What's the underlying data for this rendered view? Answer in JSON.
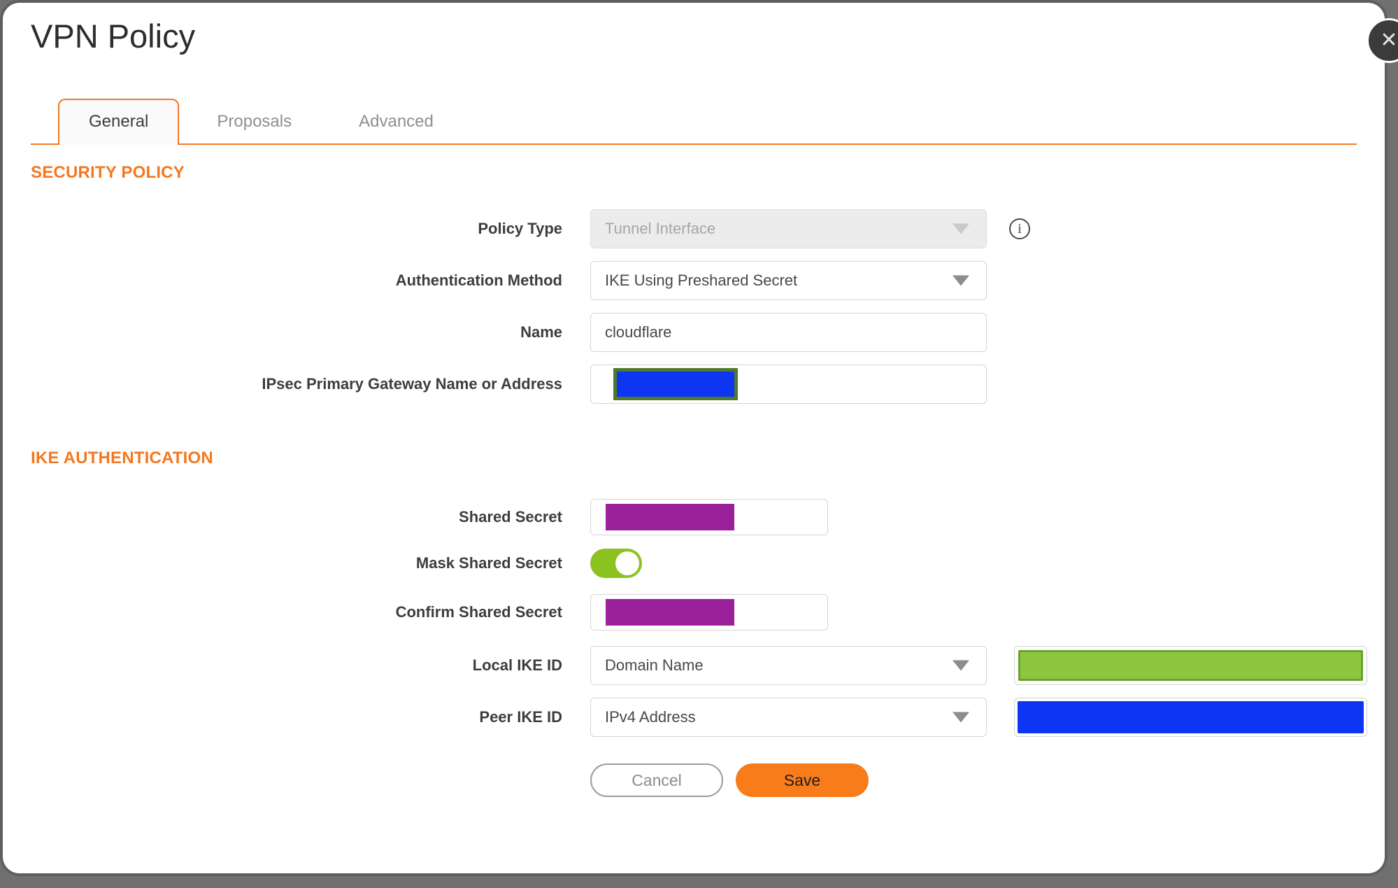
{
  "dialog": {
    "title": "VPN Policy"
  },
  "icons": {
    "close": "✕",
    "info": "i"
  },
  "tabs": [
    {
      "label": "General",
      "active": true
    },
    {
      "label": "Proposals",
      "active": false
    },
    {
      "label": "Advanced",
      "active": false
    }
  ],
  "sections": {
    "security_policy": {
      "heading": "SECURITY POLICY"
    },
    "ike_authentication": {
      "heading": "IKE AUTHENTICATION"
    }
  },
  "fields": {
    "policy_type": {
      "label": "Policy Type",
      "value": "Tunnel Interface",
      "disabled": true
    },
    "authentication_method": {
      "label": "Authentication Method",
      "value": "IKE Using Preshared Secret"
    },
    "name": {
      "label": "Name",
      "value": "cloudflare"
    },
    "ipsec_primary_gateway": {
      "label": "IPsec Primary Gateway Name or Address",
      "value": "",
      "redaction": "blue-box-olive-border"
    },
    "shared_secret": {
      "label": "Shared Secret",
      "value": "",
      "redaction": "purple-box"
    },
    "mask_shared_secret": {
      "label": "Mask Shared Secret",
      "state": "on"
    },
    "confirm_shared_secret": {
      "label": "Confirm Shared Secret",
      "value": "",
      "redaction": "purple-box"
    },
    "local_ike_id": {
      "label": "Local IKE ID",
      "value": "Domain Name",
      "id_redaction": "green-box"
    },
    "peer_ike_id": {
      "label": "Peer IKE ID",
      "value": "IPv4 Address",
      "id_redaction": "blue-box"
    }
  },
  "buttons": {
    "cancel": "Cancel",
    "save": "Save"
  },
  "colors": {
    "accent": "#F4781F",
    "save_orange": "#F97C1B",
    "toggle_green": "#8CC220",
    "redaction_purple": "#9B219B",
    "redaction_blue": "#0D35F2",
    "redaction_green": "#8CC63F",
    "redaction_green_border": "#68A22D",
    "redaction_olive_border": "#4E7A2B"
  }
}
